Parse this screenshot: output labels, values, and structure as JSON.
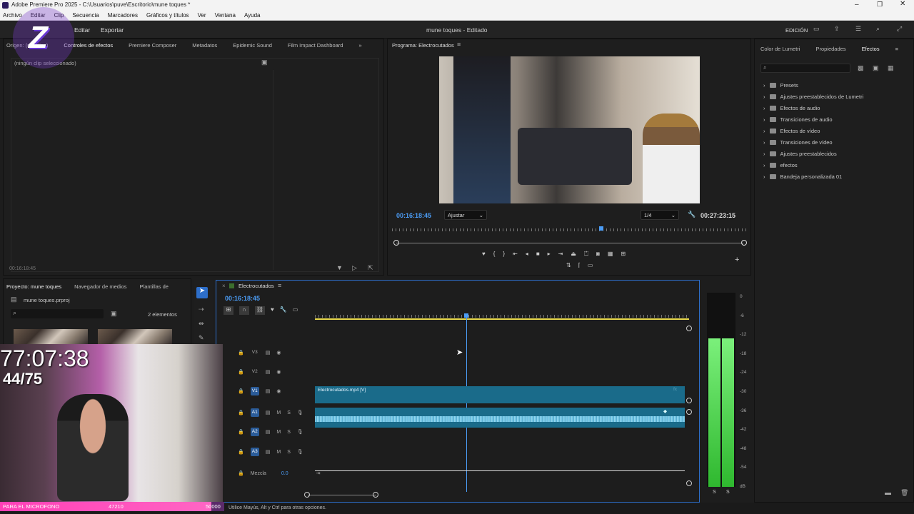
{
  "window": {
    "title": "Adobe Premiere Pro 2025 - C:\\Usuarios\\puve\\Escritorio\\mune toques *"
  },
  "menu": [
    "Archivo",
    "Editar",
    "Clip",
    "Secuencia",
    "Marcadores",
    "Gráficos y títulos",
    "Ver",
    "Ventana",
    "Ayuda"
  ],
  "topbar": {
    "import": "Importar",
    "edit": "Editar",
    "export": "Exportar",
    "project_title": "mune toques - Editado",
    "workspace": "EDICIÓN"
  },
  "source_panel": {
    "tabs": [
      "Origen: (sin clips)",
      "Controles de efectos",
      "Premiere Composer",
      "Metadatos",
      "Epidemic Sound",
      "Film Impact Dashboard"
    ],
    "no_clip": "(ningún clip seleccionado)",
    "timecode": "00:16:18:45"
  },
  "program": {
    "title": "Programa: Electrocutados",
    "timecode": "00:16:18:45",
    "fit": "Ajustar",
    "quality": "1/4",
    "duration": "00:27:23:15"
  },
  "effects_panel": {
    "tabs": [
      "Color de Lumetri",
      "Propiedades",
      "Efectos"
    ],
    "items": [
      "Presets",
      "Ajustes preestablecidos de Lumetri",
      "Efectos de audio",
      "Transiciones de audio",
      "Efectos de vídeo",
      "Transiciones de vídeo",
      "Ajustes preestablecidos",
      "efectos",
      "Bandeja personalizada 01"
    ]
  },
  "project": {
    "tabs": [
      "Proyecto: mune toques",
      "Navegador de medios",
      "Plantillas de"
    ],
    "file": "mune toques.prproj",
    "count": "2 elementos"
  },
  "timeline": {
    "sequence": "Electrocutados",
    "timecode": "00:16:18:45",
    "clip_video": "Electrocutados.mp4 [V]",
    "tracks_video": [
      "V3",
      "V2",
      "V1"
    ],
    "tracks_audio": [
      "A1",
      "A2",
      "A3"
    ],
    "mix_label": "Mezcla",
    "mix_value": "0.0",
    "track_letters": {
      "m": "M",
      "s": "S"
    }
  },
  "meter": {
    "labels": [
      "0",
      "-6",
      "-12",
      "-18",
      "-24",
      "-30",
      "-36",
      "-42",
      "-48",
      "-54",
      "dB"
    ],
    "solo": [
      "S",
      "S"
    ]
  },
  "status": {
    "hint": "Utilice Mayús, Alt y Ctrl para otras opciones."
  },
  "overlay": {
    "timer": "77:07:38",
    "counter": "44/75",
    "bar_label": "PARA EL MICROFONO",
    "bar_value": "47210",
    "bar_goal": "50000",
    "bar_fraction": 0.944
  }
}
